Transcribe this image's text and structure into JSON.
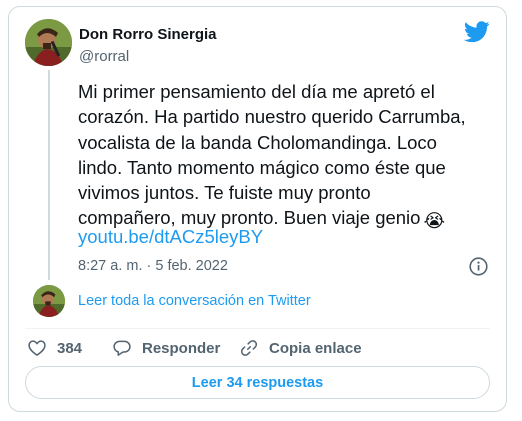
{
  "tweet": {
    "author_name": "Don Rorro Sinergia",
    "author_handle": "@rorral",
    "text": "Mi primer pensamiento del día me apretó el\ncorazón. Ha partido nuestro querido Carrumba,\nvocalista de la banda Cholomandinga. Loco\nlindo. Tanto momento mágico como éste que\nvivimos juntos. Te fuiste muy pronto\ncompañero, muy pronto. Buen viaje genio",
    "emoji": "😭",
    "link": "youtu.be/dtACz5leyBY",
    "timestamp": "8:27 a. m. · 5 feb. 2022"
  },
  "thread": {
    "read_conversation_label": "Leer toda la conversación en Twitter"
  },
  "actions": {
    "like_count": "384",
    "reply_label": "Responder",
    "copy_link_label": "Copia enlace"
  },
  "footer": {
    "read_replies_label": "Leer 34 respuestas"
  },
  "colors": {
    "accent": "#1d9bf0",
    "text_primary": "#0f1419",
    "text_secondary": "#536471",
    "border": "#cfd9de"
  },
  "icons": [
    "twitter-bird-icon",
    "info-icon",
    "heart-icon",
    "reply-icon",
    "link-icon"
  ]
}
